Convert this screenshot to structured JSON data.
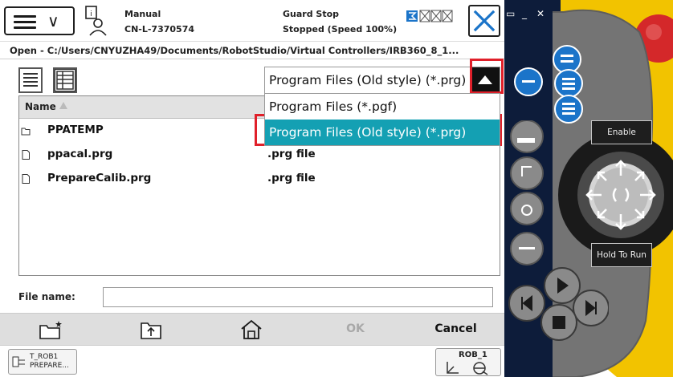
{
  "header": {
    "mode_line1": "Manual",
    "mode_line2": "CN-L-7370574",
    "guard_line1": "Guard Stop",
    "guard_line2": "Stopped (Speed 100%)"
  },
  "path": "Open - C:/Users/CNYUZHA49/Documents/RobotStudio/Virtual Controllers/IRB360_8_1...",
  "filetype": {
    "current": "Program Files (Old style) (*.prg)",
    "options": [
      "Program Files (*.pgf)",
      "Program Files (Old style) (*.prg)"
    ],
    "selected_index": 1
  },
  "filelist": {
    "header_name": "Name",
    "rows": [
      {
        "name": "PPATEMP",
        "type": "",
        "icon": "folder-icon"
      },
      {
        "name": "ppacal.prg",
        "type": ".prg file",
        "icon": "file-icon"
      },
      {
        "name": "PrepareCalib.prg",
        "type": ".prg file",
        "icon": "file-icon"
      }
    ]
  },
  "filename": {
    "label": "File name:",
    "value": ""
  },
  "toolbar": {
    "ok_label": "OK",
    "cancel_label": "Cancel"
  },
  "taskbar": {
    "task_line1": "T_ROB1",
    "task_line2": "PREPARE...",
    "rob_label": "ROB_1"
  },
  "pendant": {
    "enable_label": "Enable",
    "hold_label": "Hold To Run"
  },
  "colors": {
    "selected_option": "#14a0b3",
    "highlight_box": "#e0202a",
    "pendant_yellow": "#f2c300",
    "pendant_gray": "#6f6f6f",
    "pendant_blue": "#1b74c9"
  }
}
